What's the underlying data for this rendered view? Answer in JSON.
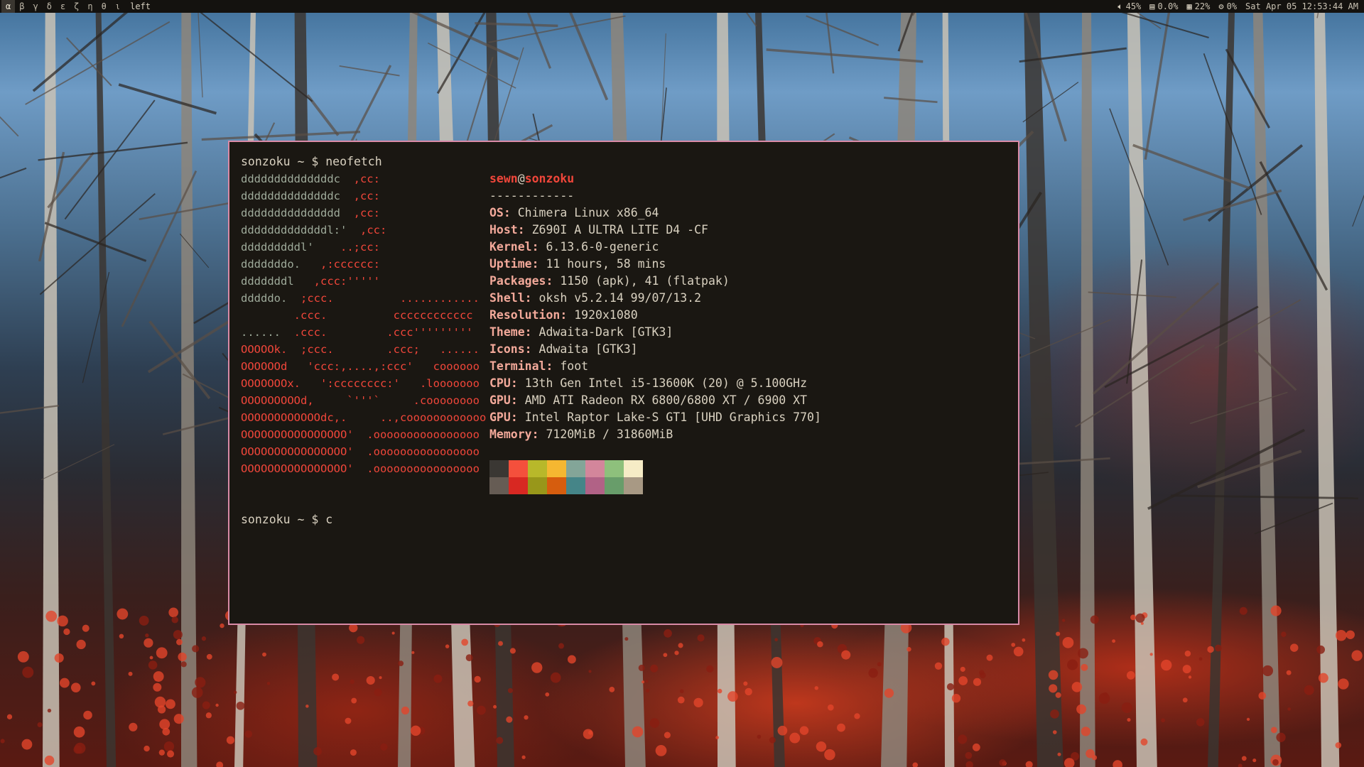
{
  "topbar": {
    "workspaces": [
      "α",
      "β",
      "γ",
      "δ",
      "ε",
      "ζ",
      "η",
      "θ",
      "ι"
    ],
    "active_workspace": 0,
    "layout": "left",
    "status": {
      "volume": "45%",
      "disk": "0.0%",
      "memory": "22%",
      "cpu": "0%",
      "datetime": "Sat Apr 05 12:53:44 AM"
    },
    "icons": {
      "volume": "speaker-icon",
      "disk": "drive-icon",
      "memory": "memory-icon",
      "cpu": "cpu-icon"
    }
  },
  "terminal": {
    "border_color": "#d98aa6",
    "background": "#1a1712",
    "prompt_command": "sonzoku ~ $ neofetch",
    "prompt_next": "sonzoku ~ $ c",
    "logo": [
      {
        "grey": "ddddddddddddddc  ",
        "red": ",cc:"
      },
      {
        "grey": "ddddddddddddddc  ",
        "red": ",cc:"
      },
      {
        "grey": "ddddddddddddddd  ",
        "red": ",cc:"
      },
      {
        "grey": "dddddddddddddl:'  ",
        "red": ",cc:"
      },
      {
        "grey": "dddddddddl'    ",
        "red": "..;cc:"
      },
      {
        "grey": "dddddddo.   ",
        "red": ",:cccccc:"
      },
      {
        "grey": "dddddddl   ",
        "red": ",ccc:'''''"
      },
      {
        "grey": "dddddo.  ",
        "red": ";ccc.          ............"
      },
      {
        "grey": "        ",
        "red": ".ccc.          cccccccccccc"
      },
      {
        "grey": "......  ",
        "red": ".ccc.         .ccc'''''''''"
      },
      {
        "grey": "",
        "red": "OOOOOk.  ;ccc.        .ccc;   ......"
      },
      {
        "grey": "",
        "red": "OOOOOOd   'ccc:,....,:ccc'   coooooo"
      },
      {
        "grey": "",
        "red": "OOOOOOOx.   ':cccccccc:'   .looooooo"
      },
      {
        "grey": "",
        "red": "OOOOOOOOOd,     `'''`     .coooooooo"
      },
      {
        "grey": "",
        "red": "OOOOOOOOOOOOdc,.     ..,coooooooooooo"
      },
      {
        "grey": "",
        "red": "OOOOOOOOOOOOOOOO'  .oooooooooooooooo"
      },
      {
        "grey": "",
        "red": "OOOOOOOOOOOOOOOO'  .oooooooooooooooo"
      },
      {
        "grey": "",
        "red": "OOOOOOOOOOOOOOOO'  .oooooooooooooooo"
      }
    ],
    "user": "sewn",
    "at": "@",
    "host": "sonzoku",
    "separator": "------------",
    "info": [
      {
        "key": "OS",
        "value": "Chimera Linux x86_64"
      },
      {
        "key": "Host",
        "value": "Z690I A ULTRA LITE D4 -CF"
      },
      {
        "key": "Kernel",
        "value": "6.13.6-0-generic"
      },
      {
        "key": "Uptime",
        "value": "11 hours, 58 mins"
      },
      {
        "key": "Packages",
        "value": "1150 (apk), 41 (flatpak)"
      },
      {
        "key": "Shell",
        "value": "oksh v5.2.14 99/07/13.2"
      },
      {
        "key": "Resolution",
        "value": "1920x1080"
      },
      {
        "key": "Theme",
        "value": "Adwaita-Dark [GTK3]"
      },
      {
        "key": "Icons",
        "value": "Adwaita [GTK3]"
      },
      {
        "key": "Terminal",
        "value": "foot"
      },
      {
        "key": "CPU",
        "value": "13th Gen Intel i5-13600K (20) @ 5.100GHz"
      },
      {
        "key": "GPU",
        "value": "AMD ATI Radeon RX 6800/6800 XT / 6900 XT"
      },
      {
        "key": "GPU",
        "value": "Intel Raptor Lake-S GT1 [UHD Graphics 770]"
      },
      {
        "key": "Memory",
        "value": "7120MiB / 31860MiB"
      }
    ],
    "palette_top": [
      "#3a3733",
      "#f4503c",
      "#b8b82a",
      "#f5b731",
      "#83a598",
      "#d3869b",
      "#8ec07c",
      "#f6ecc6"
    ],
    "palette_bottom": [
      "#665c54",
      "#d82822",
      "#98971a",
      "#d65d0e",
      "#458588",
      "#b16286",
      "#689d6a",
      "#a89984"
    ]
  }
}
